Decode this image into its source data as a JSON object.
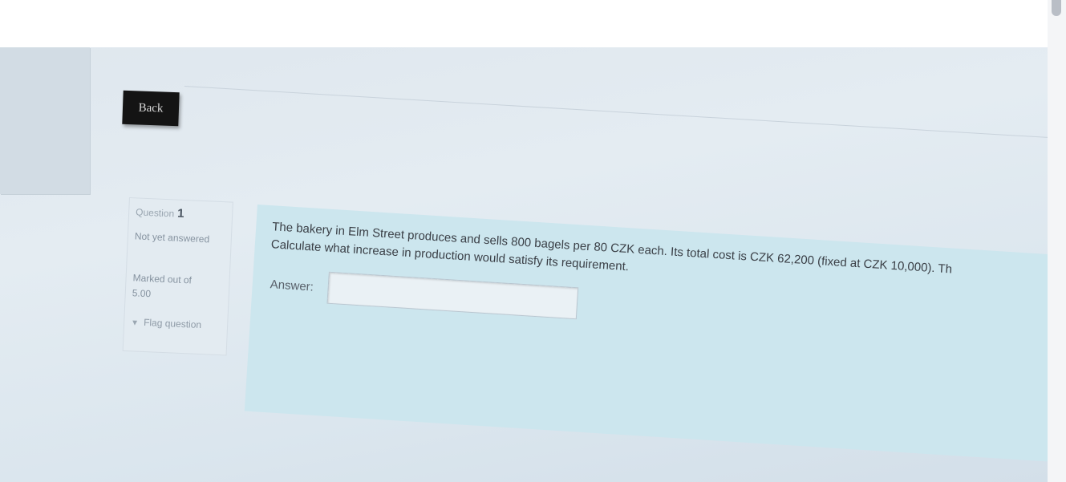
{
  "navigation": {
    "back_label": "Back"
  },
  "question_info": {
    "question_label": "Question",
    "question_number": "1",
    "state": "Not yet answered",
    "marks": "Marked out of 5.00",
    "flag_label": "Flag question",
    "flag_icon": "flag-icon"
  },
  "question": {
    "line1": "The bakery in Elm Street produces and sells 800 bagels per 80 CZK each.  Its total cost is CZK 62,200 (fixed at CZK 10,000).  Th",
    "line2": "Calculate what increase in production would satisfy its requirement.",
    "answer_label": "Answer:",
    "answer_value": ""
  },
  "colors": {
    "question_background": "#cce6ee",
    "back_button": "#141414"
  }
}
